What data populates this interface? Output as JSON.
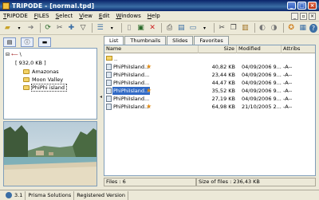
{
  "window": {
    "title": "TRIPODE - [normal.tpd]"
  },
  "menu": {
    "items": [
      {
        "first": "T",
        "rest": "RIPODE"
      },
      {
        "first": "F",
        "rest": "ILES"
      },
      {
        "first": "S",
        "rest": "elect"
      },
      {
        "first": "V",
        "rest": "iew"
      },
      {
        "first": "E",
        "rest": "dit"
      },
      {
        "first": "W",
        "rest": "indows"
      },
      {
        "first": "H",
        "rest": "elp"
      }
    ]
  },
  "tree": {
    "root": "[ 932,0 KB ]",
    "items": [
      "Amazonas",
      "Moon Valley",
      "PhiPhi island"
    ]
  },
  "tabs": [
    "List",
    "Thumbnails",
    "Slides",
    "Favorites"
  ],
  "filelist": {
    "columns": [
      "Name",
      "Size",
      "Modified",
      "Attribs"
    ],
    "up": "..",
    "rows": [
      {
        "name": "PhiPhiIsland...",
        "size": "40,82 KB",
        "modified": "04/09/2006 9...",
        "attr": "-A--",
        "star": true,
        "selected": false
      },
      {
        "name": "PhiPhiIsland...",
        "size": "23,44 KB",
        "modified": "04/09/2006 9...",
        "attr": "-A--",
        "star": false,
        "selected": false
      },
      {
        "name": "PhiPhiIsland...",
        "size": "44,47 KB",
        "modified": "04/09/2006 9...",
        "attr": "-A--",
        "star": false,
        "selected": false
      },
      {
        "name": "PhiPhiIsland...",
        "size": "35,52 KB",
        "modified": "04/09/2006 9...",
        "attr": "-A--",
        "star": true,
        "selected": true
      },
      {
        "name": "PhiPhiIsland...",
        "size": "27,19 KB",
        "modified": "04/09/2006 9...",
        "attr": "-A--",
        "star": false,
        "selected": false
      },
      {
        "name": "PhiPhiIsland...",
        "size": "64,98 KB",
        "modified": "21/10/2005 2...",
        "attr": "-A--",
        "star": true,
        "selected": false
      }
    ],
    "files_count": "Files : 6",
    "files_size": "Size of files : 236,43 KB"
  },
  "status": {
    "version": "3.1",
    "company": "Prisma Solutions",
    "registered": "Registered Version"
  },
  "colors": {
    "selection": "#316AC5",
    "titlebar": "#0A246A",
    "star": "#E08A10"
  }
}
